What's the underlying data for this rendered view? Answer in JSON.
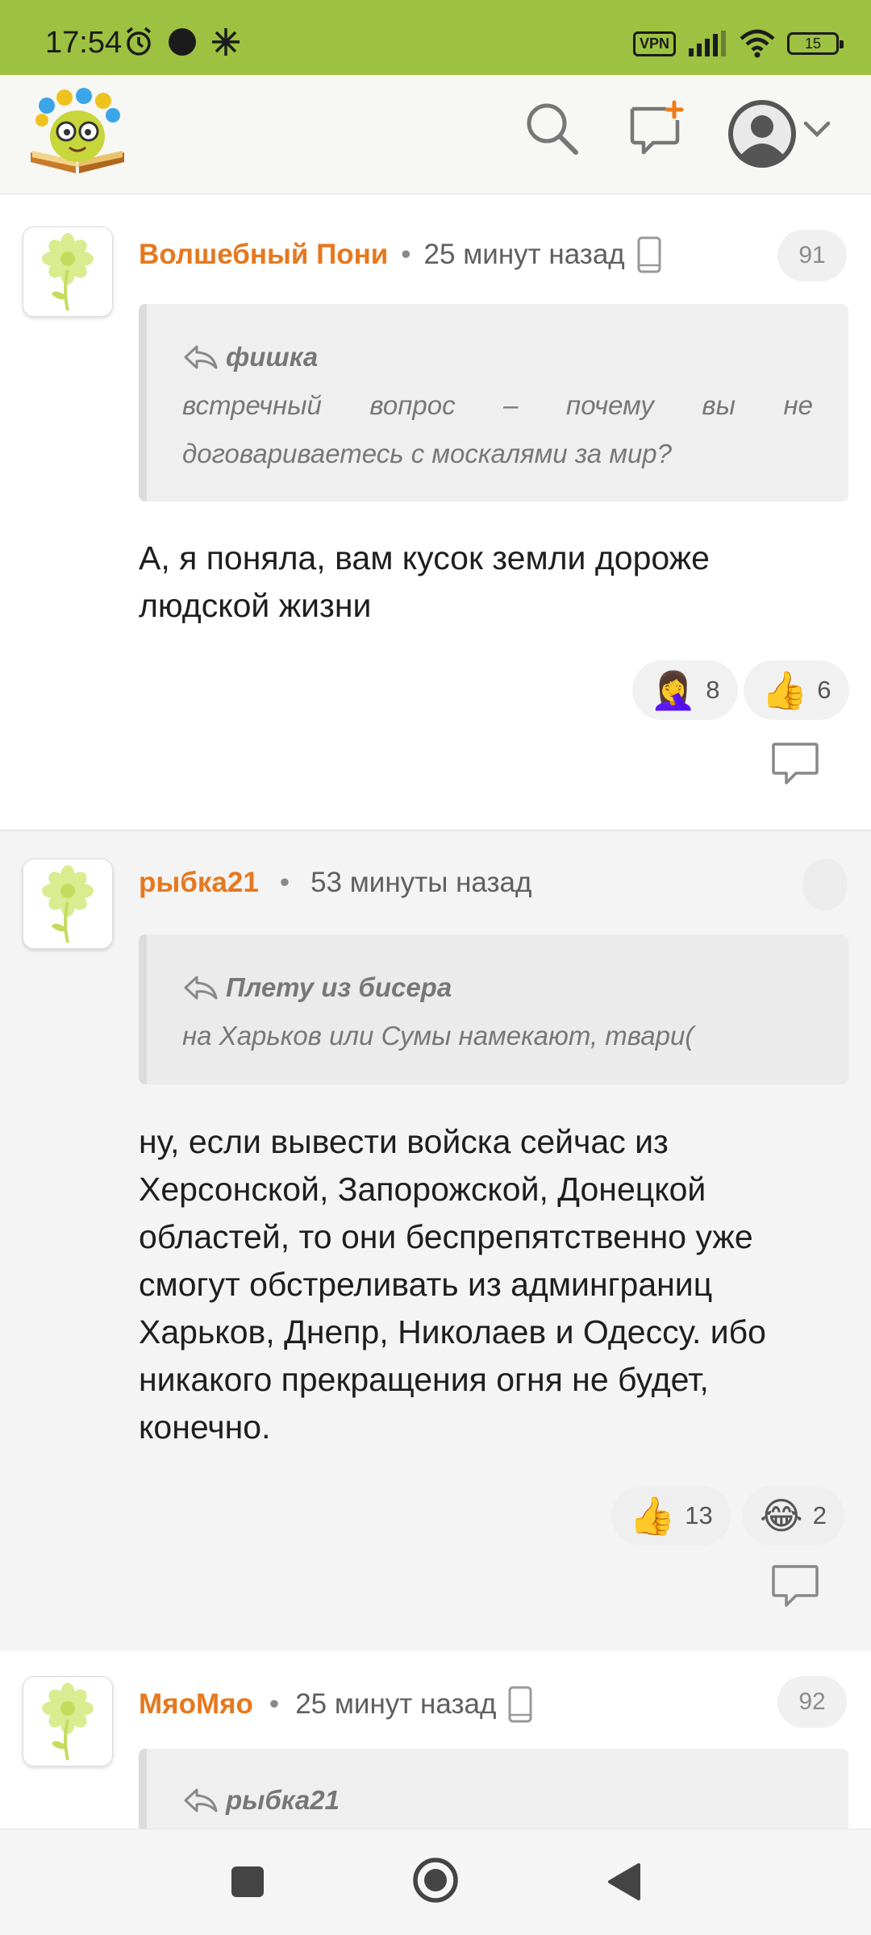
{
  "status_bar": {
    "time": "17:54",
    "vpn": "VPN",
    "battery": "15"
  },
  "app_bar": {
    "logo_icon": "book-flower-logo",
    "search_icon": "search-icon",
    "new_comment_icon": "add-comment-icon",
    "profile_icon": "user-avatar-icon"
  },
  "comments": [
    {
      "author": "Волшебный Пони",
      "dot": "•",
      "time": "25 минут назад",
      "device_icon": "mobile-icon",
      "number": "91",
      "quote_author": "фишка",
      "quote_text": "встречный вопрос – почему вы не договариваетесь с москалями за мир?",
      "text": "А, я поняла, вам кусок земли дороже людской жизни",
      "reactions": [
        {
          "emoji": "🤦‍♀️",
          "count": "8"
        },
        {
          "emoji": "👍",
          "count": "6"
        }
      ]
    },
    {
      "author": "рыбка21",
      "dot": "•",
      "time": "53 минуты назад",
      "number": "",
      "quote_author": "Плету из бисера",
      "quote_text": "на Харьков или Сумы намекают, твари(",
      "text": "ну, если вывести войска сейчас из Херсонской, Запорожской, Донецкой областей, то они беспрепятственно уже смогут обстреливать из админграниц Харьков, Днепр, Николаев и Одессу. ибо никакого прекращения огня не будет, конечно.",
      "reactions": [
        {
          "emoji": "👍",
          "count": "13"
        },
        {
          "emoji": "😂",
          "count": "2"
        }
      ]
    },
    {
      "author": "МяоМяо",
      "dot": "•",
      "time": "25 минут назад",
      "device_icon": "mobile-icon",
      "number": "92",
      "quote_author": "рыбка21"
    }
  ],
  "nav_bar": {
    "recents_icon": "square-icon",
    "home_icon": "circle-icon",
    "back_icon": "triangle-back-icon"
  },
  "colors": {
    "status_bar": "#9dc141",
    "author": "#e6781e",
    "app_bar": "#f7f7f4"
  }
}
